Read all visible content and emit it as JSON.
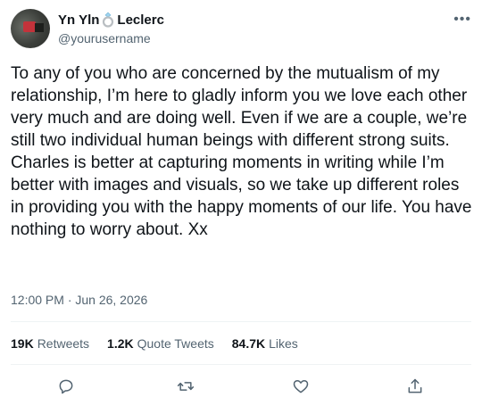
{
  "user": {
    "display_name": "Yn Yln",
    "display_name_suffix": "Leclerc",
    "emoji": "ring",
    "handle": "@yourusername"
  },
  "tweet": {
    "text": "To any of you who are concerned by the mutualism of my relationship, I’m here to gladly inform you we love each other very much and are doing well. Even if we are a couple, we’re still two individual human beings with different strong suits. Charles is better at capturing moments in writing while I’m better with images and visuals, so we take up different roles in providing you with the happy moments of our life. You have nothing to worry about. Xx",
    "timestamp": "12:00 PM · Jun 26, 2026"
  },
  "stats": {
    "retweets_count": "19K",
    "retweets_label": "Retweets",
    "quotes_count": "1.2K",
    "quotes_label": "Quote Tweets",
    "likes_count": "84.7K",
    "likes_label": "Likes"
  },
  "icons": {
    "more": "more-icon",
    "reply": "reply-icon",
    "retweet": "retweet-icon",
    "like": "heart-icon",
    "share": "share-icon"
  },
  "colors": {
    "text_primary": "#0f1419",
    "text_secondary": "#536471",
    "divider": "#eff3f4",
    "icon_gray": "#536471"
  }
}
